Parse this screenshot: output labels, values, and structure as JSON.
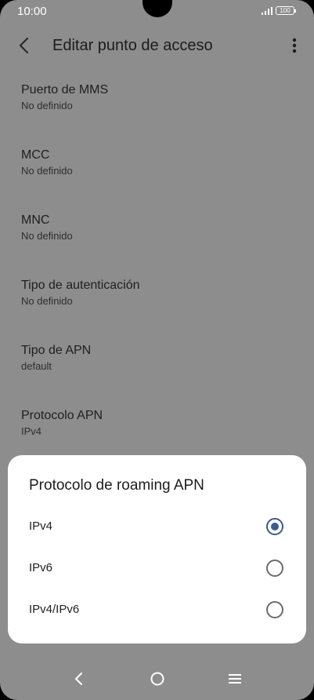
{
  "status_bar": {
    "time": "10:00",
    "battery": "100"
  },
  "app_bar": {
    "title": "Editar punto de acceso"
  },
  "settings": [
    {
      "label": "Puerto de MMS",
      "value": "No definido"
    },
    {
      "label": "MCC",
      "value": "No definido"
    },
    {
      "label": "MNC",
      "value": "No definido"
    },
    {
      "label": "Tipo de autenticación",
      "value": "No definido"
    },
    {
      "label": "Tipo de APN",
      "value": "default"
    },
    {
      "label": "Protocolo APN",
      "value": "IPv4"
    }
  ],
  "dialog": {
    "title": "Protocolo de roaming APN",
    "options": [
      {
        "label": "IPv4",
        "selected": true
      },
      {
        "label": "IPv6",
        "selected": false
      },
      {
        "label": "IPv4/IPv6",
        "selected": false
      }
    ]
  },
  "colors": {
    "accent": "#3d5a8c",
    "scrim": "#8d8d8d"
  },
  "icons": [
    "back-arrow-icon",
    "more-vert-icon",
    "signal-icon",
    "battery-icon",
    "nav-back-icon",
    "nav-home-icon",
    "nav-menu-icon"
  ]
}
